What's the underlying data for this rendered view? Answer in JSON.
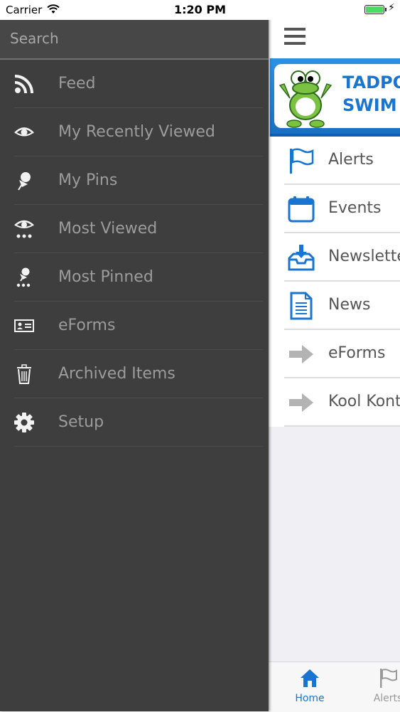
{
  "status_bar": {
    "carrier": "Carrier",
    "time": "1:20 PM",
    "battery_icon": "battery-full-icon",
    "wifi_icon": "wifi-icon"
  },
  "drawer": {
    "search": {
      "placeholder": "Search",
      "value": ""
    },
    "items": [
      {
        "label": "Feed",
        "icon": "rss-feed-icon"
      },
      {
        "label": "My Recently Viewed",
        "icon": "eye-icon"
      },
      {
        "label": "My Pins",
        "icon": "pin-icon"
      },
      {
        "label": "Most Viewed",
        "icon": "eye-dots-icon"
      },
      {
        "label": "Most Pinned",
        "icon": "pin-dots-icon"
      },
      {
        "label": "eForms",
        "icon": "id-card-icon"
      },
      {
        "label": "Archived Items",
        "icon": "trash-icon"
      },
      {
        "label": "Setup",
        "icon": "gear-icon"
      }
    ]
  },
  "main": {
    "menu_icon": "hamburger-icon",
    "banner_text": "TADPO\nSWIM S",
    "list": [
      {
        "label": "Alerts",
        "icon": "flag-icon"
      },
      {
        "label": "Events",
        "icon": "calendar-icon"
      },
      {
        "label": "Newslette",
        "icon": "download-tray-icon"
      },
      {
        "label": "News",
        "icon": "document-icon"
      },
      {
        "label": "eForms",
        "icon": "arrow-right-icon"
      },
      {
        "label": "Kool Kont",
        "icon": "arrow-right-icon"
      }
    ]
  },
  "tab_bar": {
    "tabs": [
      {
        "label": "Home",
        "icon": "home-icon",
        "active": true
      },
      {
        "label": "Alerts",
        "icon": "flag-icon",
        "active": false
      }
    ]
  },
  "colors": {
    "accent": "#1a75d1",
    "drawer_bg": "#3e3e3e",
    "drawer_text": "#9c9c9c",
    "arrow_gray": "#b3b3b3"
  }
}
